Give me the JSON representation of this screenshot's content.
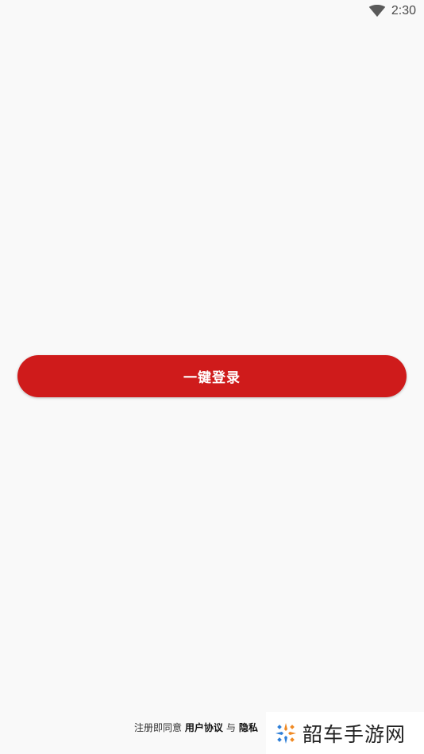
{
  "status_bar": {
    "time": "2:30",
    "wifi_icon": "wifi-icon"
  },
  "login": {
    "button_label": "一键登录"
  },
  "agreement": {
    "prefix": "注册即同意",
    "user_agreement": "用户协议",
    "conjunction": "与",
    "privacy_policy": "隐私"
  },
  "watermark": {
    "text": "韶车手游网",
    "logo_icon": "sparkle-logo-icon"
  },
  "colors": {
    "accent": "#cf1b1b",
    "background": "#f9f9f9"
  }
}
